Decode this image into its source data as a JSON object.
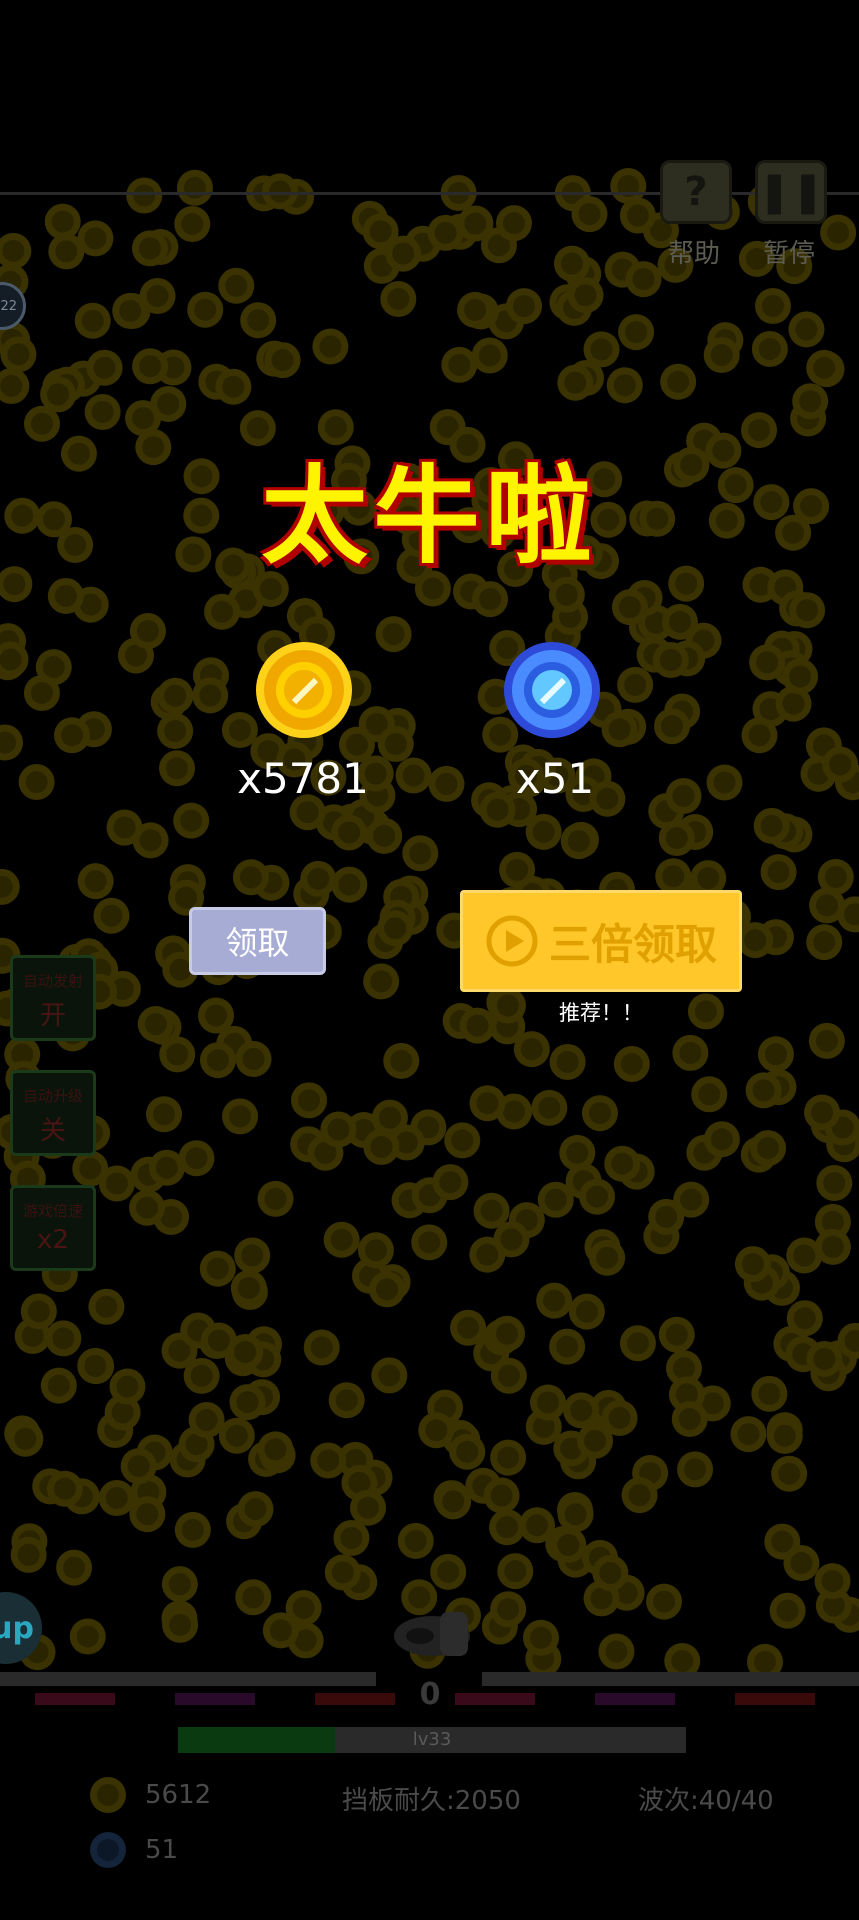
{
  "colors": {
    "background": "#000000",
    "coin_dim": "#3a3200",
    "title_fill": "#fff400",
    "title_outline": "#b00000",
    "claim_button": "#a7acd4",
    "triple_button": "#ffc72a",
    "xp_bar_fill": "#0a3a10"
  },
  "top_controls": {
    "help_icon": "question-icon",
    "help_label": "帮助",
    "pause_icon": "pause-icon",
    "pause_label": "暂停"
  },
  "level_badge": "22",
  "side_buttons": [
    {
      "title": "自动发射",
      "value": "开"
    },
    {
      "title": "自动升级",
      "value": "关"
    },
    {
      "title": "游戏倍速",
      "value": "x2"
    }
  ],
  "reward_popup": {
    "title": "太牛啦",
    "gold_icon": "gold-coin-icon",
    "gold_amount": "x5781",
    "gem_icon": "blue-gem-icon",
    "gem_amount": "x51",
    "claim_label": "领取",
    "triple_icon": "play-video-icon",
    "triple_label": "三倍领取",
    "recommend_text": "推荐！！"
  },
  "up_button": "up",
  "paddle_count": "0",
  "level_bar": {
    "label": "lv33",
    "progress": 0.31
  },
  "stats": {
    "gold": "5612",
    "gem": "51",
    "durability": "挡板耐久:2050",
    "wave": "波次:40/40"
  }
}
